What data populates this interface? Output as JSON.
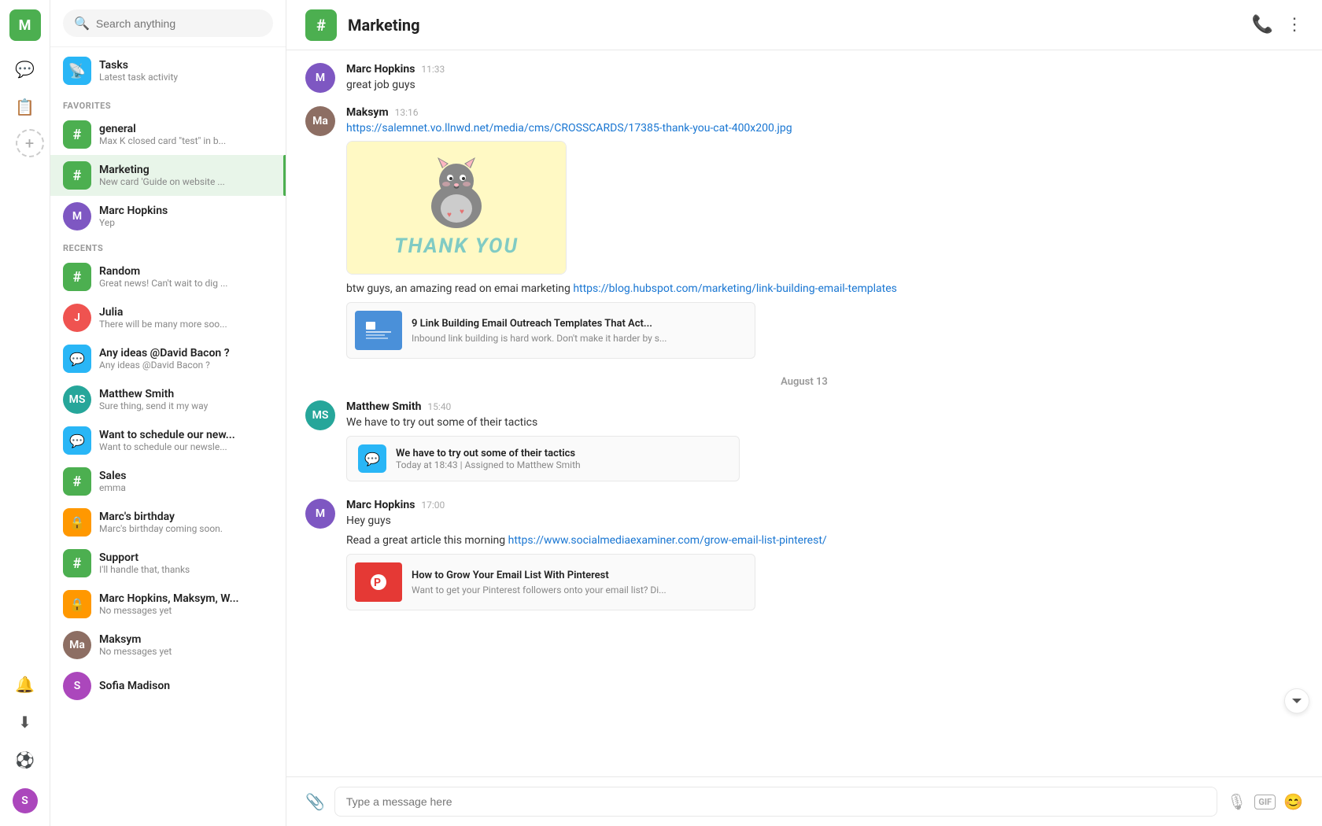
{
  "app": {
    "user_initial": "M",
    "title": "Marketing"
  },
  "sidebar": {
    "nav_icons": [
      {
        "name": "chat-icon",
        "symbol": "💬",
        "active": true
      },
      {
        "name": "contacts-icon",
        "symbol": "📋",
        "active": false
      },
      {
        "name": "add-icon",
        "symbol": "+",
        "active": false
      }
    ]
  },
  "search": {
    "placeholder": "Search anything"
  },
  "tasks": {
    "title": "Tasks",
    "subtitle": "Latest task activity"
  },
  "favorites_label": "FAVORITES",
  "recents_label": "RECENTS",
  "favorites": [
    {
      "id": "general",
      "type": "hash",
      "color": "ch-green",
      "name": "general",
      "preview": "Max K closed card \"test\" in b...",
      "active": false
    },
    {
      "id": "marketing",
      "type": "hash",
      "color": "ch-green",
      "name": "Marketing",
      "preview": "New card 'Guide on website ...",
      "active": true
    },
    {
      "id": "marc-hopkins",
      "type": "avatar",
      "avatar_class": "marc",
      "initials": "M",
      "name": "Marc Hopkins",
      "preview": "Yep",
      "active": false
    }
  ],
  "recents": [
    {
      "id": "random",
      "type": "hash",
      "color": "ch-green",
      "name": "Random",
      "preview": "Great news! Can't wait to dig ...",
      "active": false
    },
    {
      "id": "julia",
      "type": "avatar",
      "avatar_class": "julia",
      "initials": "J",
      "name": "Julia",
      "preview": "There will be many more soo...",
      "active": false
    },
    {
      "id": "david-bacon",
      "type": "icon",
      "color": "ch-blue",
      "name": "Any ideas @David Bacon ?",
      "preview": "Any ideas @David Bacon ?",
      "active": false
    },
    {
      "id": "matthew-smith",
      "type": "avatar",
      "avatar_class": "matthew",
      "initials": "MS",
      "name": "Matthew Smith",
      "preview": "Sure thing, send it my way",
      "active": false
    },
    {
      "id": "schedule",
      "type": "icon",
      "color": "ch-blue",
      "name": "Want to schedule our new...",
      "preview": "Want to schedule our newsle...",
      "active": false
    },
    {
      "id": "sales",
      "type": "hash",
      "color": "ch-green",
      "name": "Sales",
      "preview": "emma",
      "active": false
    },
    {
      "id": "marcs-birthday",
      "type": "lock",
      "color": "ch-orange",
      "name": "Marc's birthday",
      "preview": "Marc's birthday coming soon.",
      "active": false
    },
    {
      "id": "support",
      "type": "hash",
      "color": "ch-green",
      "name": "Support",
      "preview": "I'll handle that, thanks",
      "active": false
    },
    {
      "id": "marc-maksym",
      "type": "lock",
      "color": "ch-orange",
      "name": "Marc Hopkins, Maksym, W...",
      "preview": "No messages yet",
      "active": false
    },
    {
      "id": "maksym",
      "type": "avatar",
      "avatar_class": "maksym",
      "initials": "Ma",
      "name": "Maksym",
      "preview": "No messages yet",
      "active": false
    },
    {
      "id": "sofia-madison",
      "type": "avatar",
      "avatar_class": "sofia",
      "initials": "S",
      "name": "Sofia Madison",
      "preview": "",
      "active": false
    }
  ],
  "chat": {
    "channel_name": "Marketing",
    "messages": [
      {
        "id": "msg1",
        "avatar_class": "marc",
        "initials": "M",
        "sender": "Marc Hopkins",
        "time": "11:33",
        "text": "great job guys"
      },
      {
        "id": "msg2",
        "avatar_class": "maksym",
        "initials": "Ma",
        "sender": "Maksym",
        "time": "13:16",
        "link": "https://salemnet.vo.llnwd.net/media/cms/CROSSCARDS/17385-thank-you-cat-400x200.jpg",
        "has_thank_you_card": true,
        "body_text": "btw guys, an amazing read on emai marketing",
        "article_link": "https://blog.hubspot.com/marketing/link-building-email-templates",
        "article_title": "9 Link Building Email Outreach Templates That Act...",
        "article_desc": "Inbound link building is hard work. Don't make it harder by s..."
      }
    ],
    "date_divider": "August 13",
    "messages2": [
      {
        "id": "msg3",
        "avatar_class": "matthew",
        "initials": "MS",
        "sender": "Matthew Smith",
        "time": "15:40",
        "text": "We have to try out some of their tactics",
        "has_task": true,
        "task_text": "We have to try out some of their tactics",
        "task_meta": "Today at 18:43 | Assigned to Matthew Smith"
      },
      {
        "id": "msg4",
        "avatar_class": "marc",
        "initials": "M",
        "sender": "Marc Hopkins",
        "time": "17:00",
        "text": "Hey guys",
        "body_text2": "Read a great article this morning",
        "article_link2": "https://www.socialmediaexaminer.com/grow-email-list-pinterest/",
        "article_title2": "How to Grow Your Email List With Pinterest",
        "article_desc2": "Want to get your Pinterest followers onto your email list? Di..."
      }
    ]
  },
  "input": {
    "placeholder": "Type a message here"
  }
}
